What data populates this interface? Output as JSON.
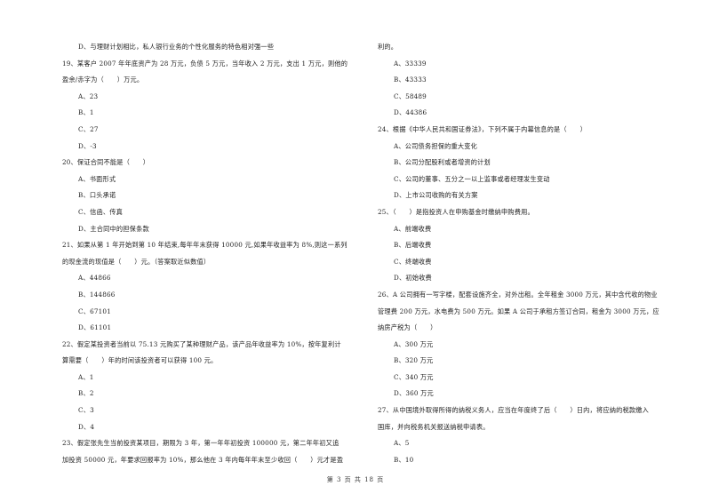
{
  "left_column": [
    {
      "type": "opt",
      "text": "D、与理财计划相比，私人银行业务的个性化服务的特色相对强一些"
    },
    {
      "type": "q",
      "text": "19、某客户 2007 年年底资产为 28 万元，负债 5 万元，当年收入 2 万元，支出 1 万元，则他的"
    },
    {
      "type": "q",
      "text": "盈余/赤字为（　　）万元。"
    },
    {
      "type": "opt",
      "text": "A、23"
    },
    {
      "type": "opt",
      "text": "B、1"
    },
    {
      "type": "opt",
      "text": "C、27"
    },
    {
      "type": "opt",
      "text": "D、-3"
    },
    {
      "type": "q",
      "text": "20、保证合同不能是（　　）"
    },
    {
      "type": "opt",
      "text": "A、书面形式"
    },
    {
      "type": "opt",
      "text": "B、口头承诺"
    },
    {
      "type": "opt",
      "text": "C、信函、传真"
    },
    {
      "type": "opt",
      "text": "D、主合同中的担保条款"
    },
    {
      "type": "q",
      "text": "21、如果从第 1 年开始到第 10 年结束,每年年末获得 10000 元,如果年收益率为 8%,则这一系列"
    },
    {
      "type": "q",
      "text": "的现金流的现值是（　　）元。（答案取近似数值）"
    },
    {
      "type": "opt",
      "text": "A、44866"
    },
    {
      "type": "opt",
      "text": "B、144866"
    },
    {
      "type": "opt",
      "text": "C、67101"
    },
    {
      "type": "opt",
      "text": "D、61101"
    },
    {
      "type": "q",
      "text": "22、假定某投资者当前以 75.13 元购买了某种理财产品，该产品年收益率为 10%，按年复利计"
    },
    {
      "type": "q",
      "text": "算需要（　　）年的时间该投资者可以获得 100 元。"
    },
    {
      "type": "opt",
      "text": "A、1"
    },
    {
      "type": "opt",
      "text": "B、2"
    },
    {
      "type": "opt",
      "text": "C、3"
    },
    {
      "type": "opt",
      "text": "D、4"
    },
    {
      "type": "q",
      "text": "23、假定张先生当前投资某项目，期限为 3 年，第一年年初投资 100000 元，第二年年初又追"
    },
    {
      "type": "q",
      "text": "加投资 50000 元，年要求回报率为 10%，那么他在 3 年内每年年末至少收回（　　）元才是盈"
    }
  ],
  "right_column": [
    {
      "type": "q",
      "text": "利的。"
    },
    {
      "type": "opt",
      "text": "A、33339"
    },
    {
      "type": "opt",
      "text": "B、43333"
    },
    {
      "type": "opt",
      "text": "C、58489"
    },
    {
      "type": "opt",
      "text": "D、44386"
    },
    {
      "type": "q",
      "text": "24、根据《中华人民共和国证券法》，下列不属于内幕信息的是（　　）"
    },
    {
      "type": "opt",
      "text": "A、公司债务担保的重大变化"
    },
    {
      "type": "opt",
      "text": "B、公司分配股利或者增资的计划"
    },
    {
      "type": "opt",
      "text": "C、公司的董事、五分之一以上监事或者经理发生变动"
    },
    {
      "type": "opt",
      "text": "D、上市公司收购的有关方案"
    },
    {
      "type": "q",
      "text": "25、（　　）是指投资人在申购基金时缴纳申购费用。"
    },
    {
      "type": "opt",
      "text": "A、前端收费"
    },
    {
      "type": "opt",
      "text": "B、后端收费"
    },
    {
      "type": "opt",
      "text": "C、终端收费"
    },
    {
      "type": "opt",
      "text": "D、初始收费"
    },
    {
      "type": "q",
      "text": "26、A 公司拥有一写字楼，配套设施齐全，对外出租。全年租金 3000 万元，其中含代收的物业"
    },
    {
      "type": "q",
      "text": "管理费 200 万元，水电费为 500 万元。如果 A 公司于承租方签订合同，租金为 3000 万元，应"
    },
    {
      "type": "q",
      "text": "纳房产税为（　　）"
    },
    {
      "type": "opt",
      "text": "A、300 万元"
    },
    {
      "type": "opt",
      "text": "B、320 万元"
    },
    {
      "type": "opt",
      "text": "C、340 万元"
    },
    {
      "type": "opt",
      "text": "D、360 万元"
    },
    {
      "type": "q",
      "text": "27、从中国境外取得所得的纳税义务人，应当在年度终了后（　　）日内，将应纳的税款缴入"
    },
    {
      "type": "q",
      "text": "国库，并向税务机关报送纳税申请表。"
    },
    {
      "type": "opt",
      "text": "A、5"
    },
    {
      "type": "opt",
      "text": "B、10"
    }
  ],
  "footer": {
    "page_label": "第 3 页 共 18 页"
  }
}
